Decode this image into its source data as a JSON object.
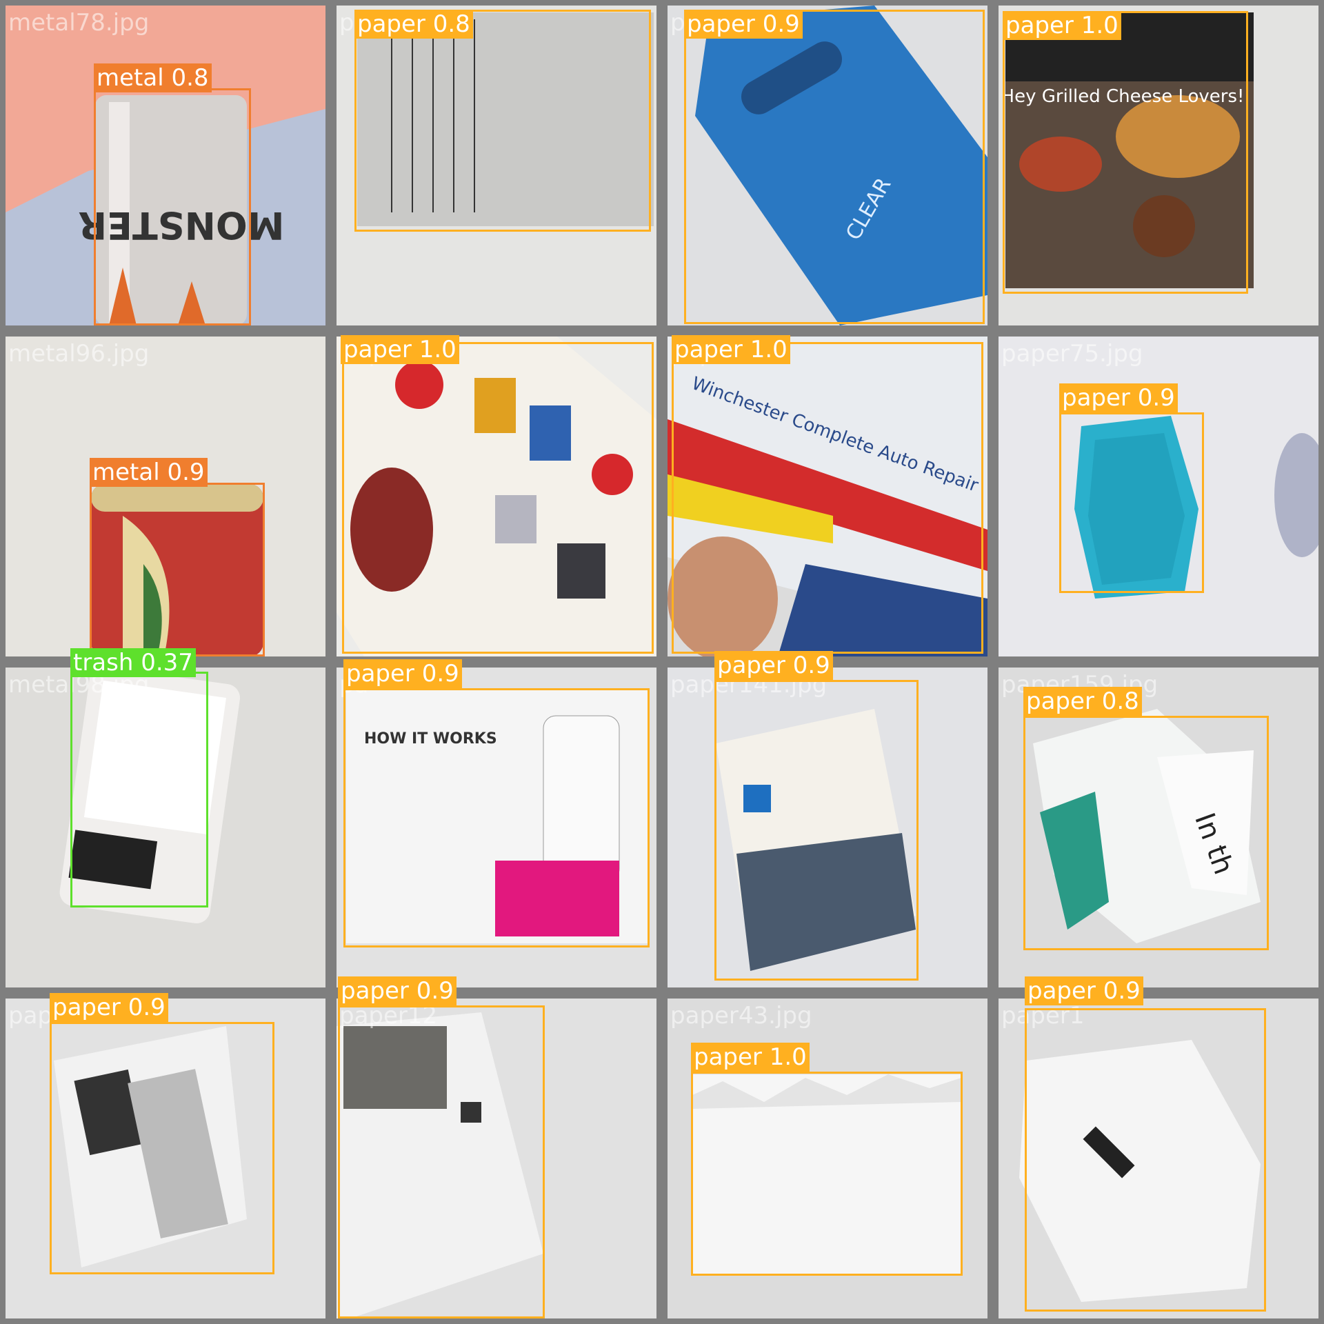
{
  "colors": {
    "paper": "#ffb020",
    "metal": "#f07e2e",
    "trash": "#5ee02c",
    "grid_bg": "#7f7f7f"
  },
  "tiles": [
    {
      "file": "metal78.jpg",
      "detections": [
        {
          "label": "metal 0.8",
          "class": "metal"
        }
      ]
    },
    {
      "file": "pa",
      "detections": [
        {
          "label": "paper 0.8",
          "class": "paper"
        }
      ]
    },
    {
      "file": "pa",
      "detections": [
        {
          "label": "paper 0.9",
          "class": "paper"
        }
      ]
    },
    {
      "file": "",
      "detections": [
        {
          "label": "paper 1.0",
          "class": "paper"
        }
      ]
    },
    {
      "file": "metal96.jpg",
      "detections": [
        {
          "label": "metal 0.9",
          "class": "metal"
        }
      ]
    },
    {
      "file": "paper1",
      "detections": [
        {
          "label": "paper 1.0",
          "class": "paper"
        }
      ]
    },
    {
      "file": "paper1",
      "detections": [
        {
          "label": "paper 1.0",
          "class": "paper"
        }
      ]
    },
    {
      "file": "paper75.jpg",
      "detections": [
        {
          "label": "paper 0.9",
          "class": "paper"
        }
      ]
    },
    {
      "file": "metal98.jpg",
      "detections": [
        {
          "label": "trash 0.37",
          "class": "trash"
        }
      ]
    },
    {
      "file": "pa",
      "detections": [
        {
          "label": "paper 0.9",
          "class": "paper"
        }
      ]
    },
    {
      "file": "paper141.jpg",
      "detections": [
        {
          "label": "paper 0.9",
          "class": "paper"
        }
      ]
    },
    {
      "file": "paper159.jpg",
      "detections": [
        {
          "label": "paper 0.8",
          "class": "paper"
        }
      ]
    },
    {
      "file": "pap",
      "detections": [
        {
          "label": "paper 0.9",
          "class": "paper"
        }
      ]
    },
    {
      "file": "paper12",
      "detections": [
        {
          "label": "paper 0.9",
          "class": "paper"
        }
      ]
    },
    {
      "file": "paper43.jpg",
      "detections": [
        {
          "label": "paper 1.0",
          "class": "paper"
        }
      ]
    },
    {
      "file": "paper1",
      "detections": [
        {
          "label": "paper 0.9",
          "class": "paper"
        }
      ]
    }
  ]
}
